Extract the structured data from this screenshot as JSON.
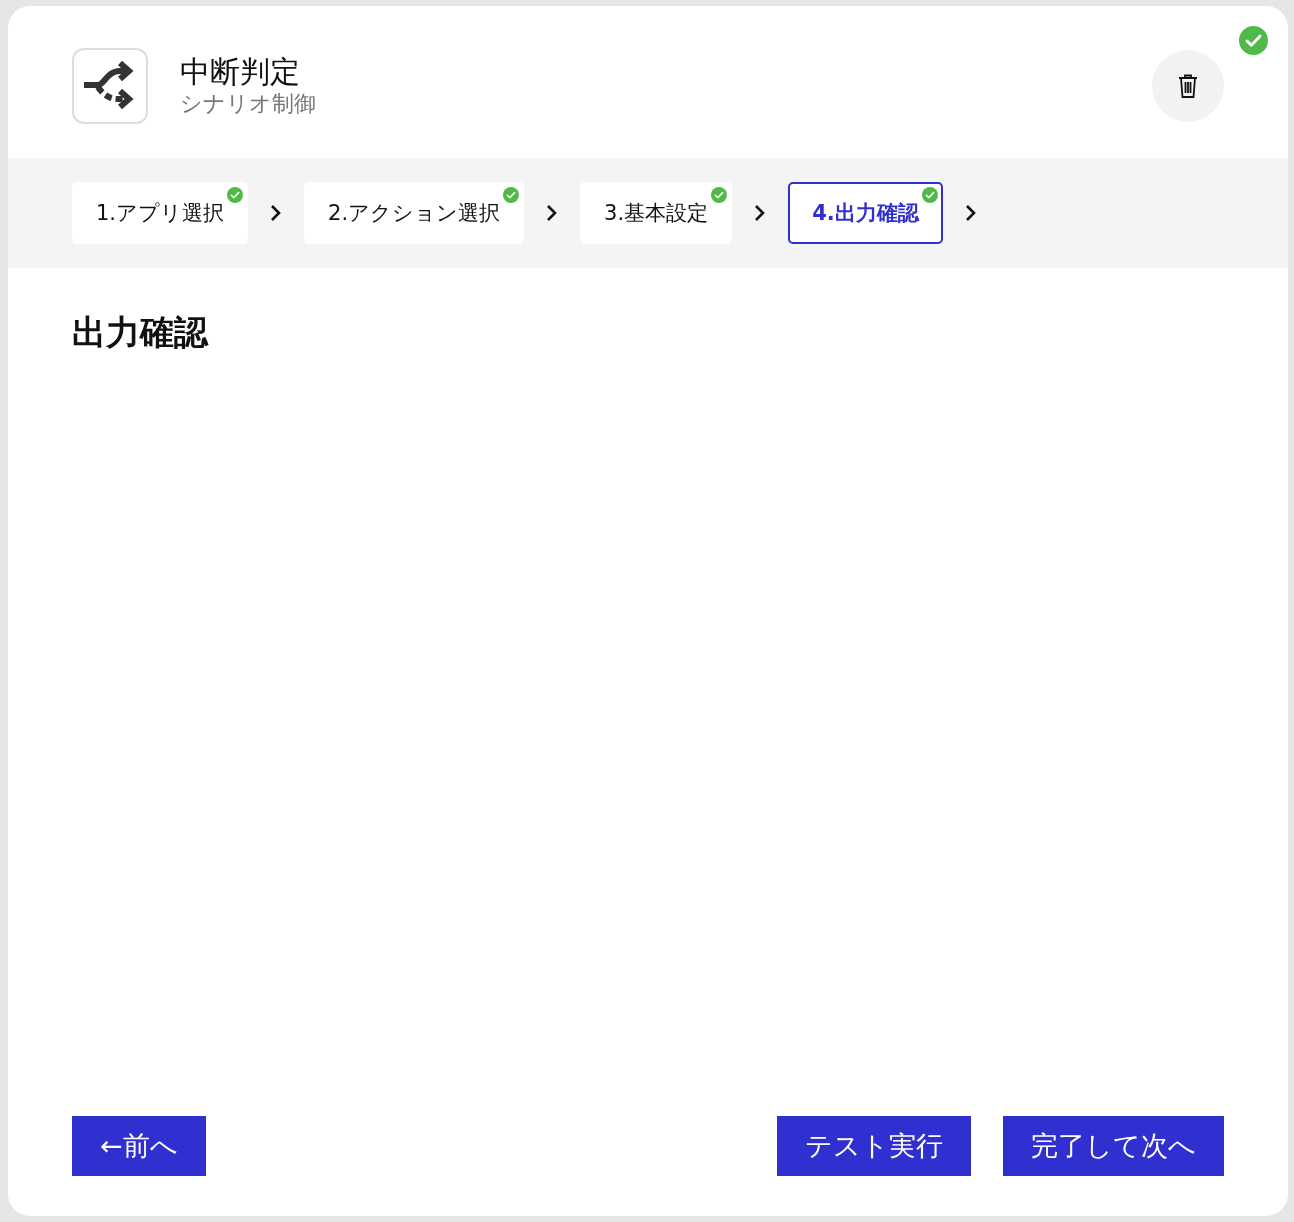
{
  "header": {
    "title": "中断判定",
    "subtitle": "シナリオ制御",
    "completed": true
  },
  "steps": [
    {
      "label": "1.アプリ選択",
      "selected": false,
      "done": true
    },
    {
      "label": "2.アクション選択",
      "selected": false,
      "done": true
    },
    {
      "label": "3.基本設定",
      "selected": false,
      "done": true
    },
    {
      "label": "4.出力確認",
      "selected": true,
      "done": true
    }
  ],
  "section_title": "出力確認",
  "buttons": [
    {
      "label": "←前へ",
      "kind": "back"
    },
    {
      "label": "テスト実行",
      "kind": "action"
    },
    {
      "label": "完了して次へ",
      "kind": "action"
    }
  ]
}
